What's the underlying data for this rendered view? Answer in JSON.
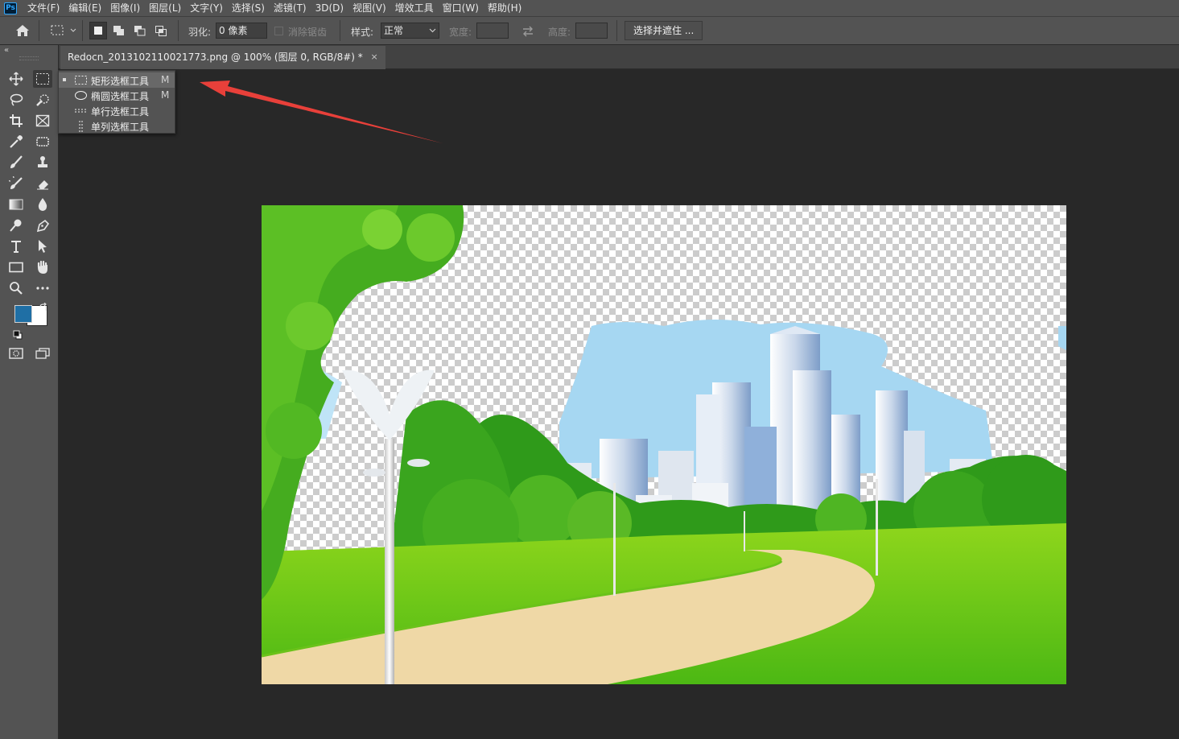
{
  "app": {
    "logo": "Ps",
    "accent": "#31a8ff"
  },
  "menu": [
    "文件(F)",
    "编辑(E)",
    "图像(I)",
    "图层(L)",
    "文字(Y)",
    "选择(S)",
    "滤镜(T)",
    "3D(D)",
    "视图(V)",
    "增效工具",
    "窗口(W)",
    "帮助(H)"
  ],
  "options": {
    "feather_label": "羽化:",
    "feather_value": "0 像素",
    "antialias_label": "消除锯齿",
    "style_label": "样式:",
    "style_value": "正常",
    "width_label": "宽度:",
    "height_label": "高度:",
    "select_mask_button": "选择并遮住 ..."
  },
  "document_tab": {
    "title": "Redocn_2013102110021773.png @ 100% (图层 0, RGB/8#) *",
    "close": "×"
  },
  "flyout": {
    "items": [
      {
        "label": "矩形选框工具",
        "shortcut": "M",
        "active": true,
        "icon": "rect-marquee-icon"
      },
      {
        "label": "椭圆选框工具",
        "shortcut": "M",
        "active": false,
        "icon": "ellipse-marquee-icon"
      },
      {
        "label": "单行选框工具",
        "shortcut": "",
        "active": false,
        "icon": "single-row-marquee-icon"
      },
      {
        "label": "单列选框工具",
        "shortcut": "",
        "active": false,
        "icon": "single-column-marquee-icon"
      }
    ]
  },
  "colors": {
    "foreground": "#1f6fa5",
    "background": "#ffffff",
    "annotation_arrow": "#e8403a"
  }
}
